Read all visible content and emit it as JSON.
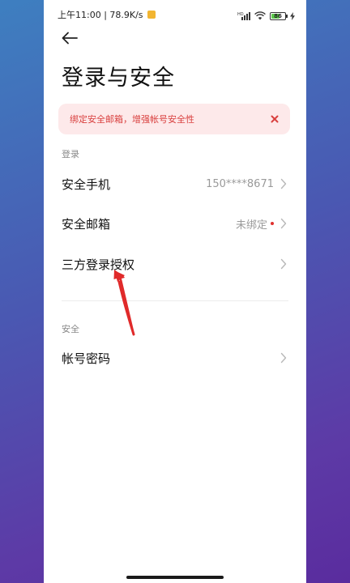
{
  "status_bar": {
    "time_speed": "上午11:00 | 78.9K/s",
    "signal_label": "HD",
    "battery_level": "86"
  },
  "header": {
    "title": "登录与安全"
  },
  "banner": {
    "text": "绑定安全邮箱，增强帐号安全性"
  },
  "sections": {
    "login_label": "登录",
    "security_label": "安全"
  },
  "rows": {
    "phone_label": "安全手机",
    "phone_value": "150****8671",
    "email_label": "安全邮箱",
    "email_value": "未绑定",
    "third_party_label": "三方登录授权",
    "password_label": "帐号密码"
  },
  "colors": {
    "accent_red": "#e0312f",
    "banner_bg": "#fde9ea",
    "annotation_arrow": "#e02a2a"
  },
  "icons": [
    "back-arrow-icon",
    "close-icon",
    "chevron-right-icon",
    "signal-icon",
    "wifi-icon",
    "battery-icon",
    "charging-icon"
  ]
}
